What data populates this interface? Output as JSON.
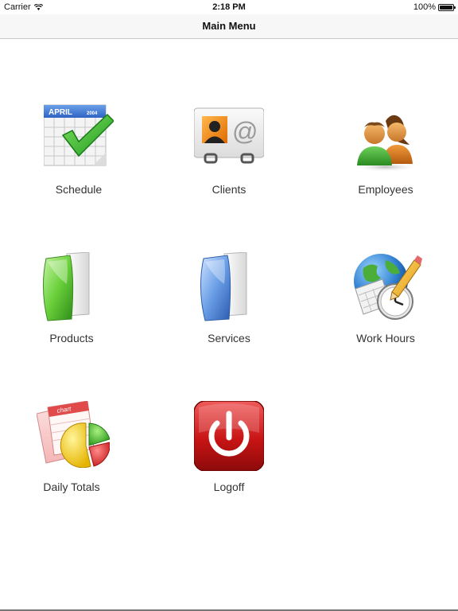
{
  "status_bar": {
    "carrier": "Carrier",
    "wifi_icon": "wifi-icon",
    "time": "2:18 PM",
    "battery": "100%",
    "battery_icon": "battery-icon"
  },
  "nav": {
    "title": "Main Menu"
  },
  "menu": {
    "items": [
      {
        "label": "Schedule",
        "icon": "calendar-check-icon",
        "calendar_month": "APRIL",
        "calendar_year": "2004"
      },
      {
        "label": "Clients",
        "icon": "contact-card-icon",
        "at_symbol": "@"
      },
      {
        "label": "Employees",
        "icon": "people-icon"
      },
      {
        "label": "Products",
        "icon": "green-folder-icon"
      },
      {
        "label": "Services",
        "icon": "blue-folder-icon"
      },
      {
        "label": "Work Hours",
        "icon": "globe-clock-icon"
      },
      {
        "label": "Daily Totals",
        "icon": "pie-chart-icon",
        "chart_text": "chart"
      },
      {
        "label": "Logoff",
        "icon": "power-icon"
      }
    ]
  }
}
